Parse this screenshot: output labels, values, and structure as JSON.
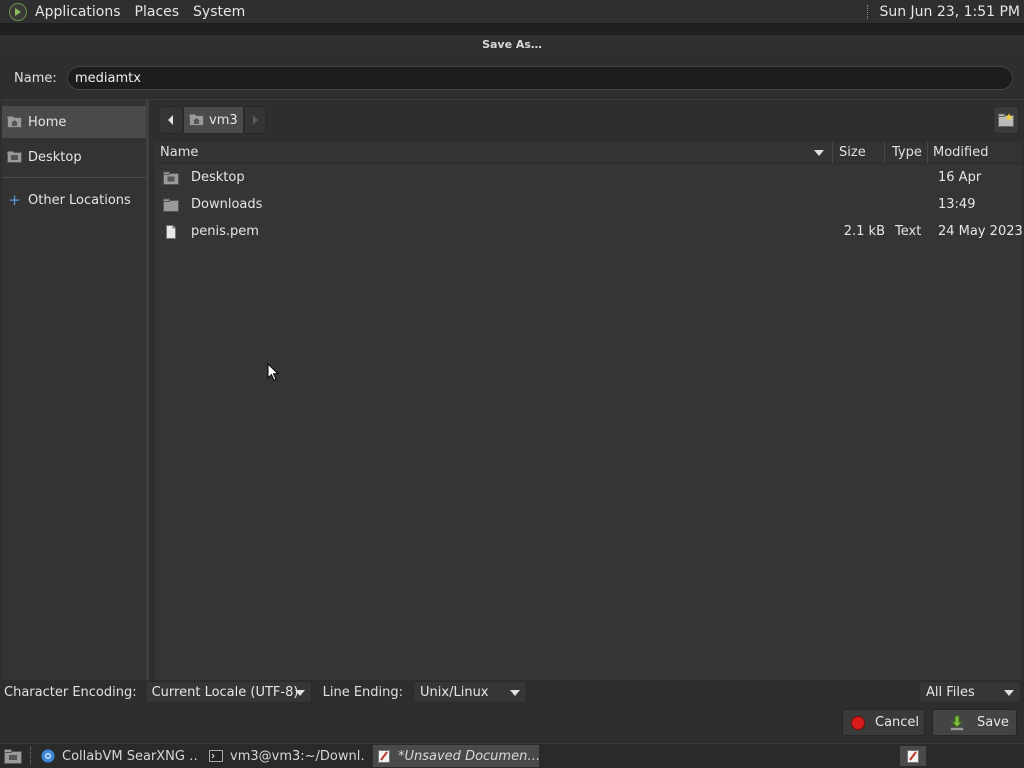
{
  "top_panel": {
    "menus": [
      "Applications",
      "Places",
      "System"
    ],
    "clock": "Sun Jun 23,  1:51 PM"
  },
  "dialog": {
    "title": "Save As…",
    "name_label": "Name:",
    "name_value": "mediamtx"
  },
  "sidebar": {
    "items": [
      {
        "label": "Home"
      },
      {
        "label": "Desktop"
      },
      {
        "label": "Other Locations"
      }
    ]
  },
  "pathbar": {
    "crumb": "vm3"
  },
  "filelist": {
    "columns": {
      "name": "Name",
      "size": "Size",
      "type": "Type",
      "modified": "Modified"
    },
    "rows": [
      {
        "name": "Desktop",
        "size": "",
        "type": "",
        "modified": "16 Apr",
        "icon": "desktop-folder-icon"
      },
      {
        "name": "Downloads",
        "size": "",
        "type": "",
        "modified": "13:49",
        "icon": "folder-icon"
      },
      {
        "name": "penis.pem",
        "size": "2.1 kB",
        "type": "Text",
        "modified": "24 May 2023",
        "icon": "text-file-icon"
      }
    ]
  },
  "options": {
    "encoding_label": "Character Encoding:",
    "encoding_value": "Current Locale (UTF-8)",
    "line_ending_label": "Line Ending:",
    "line_ending_value": "Unix/Linux",
    "filter_value": "All Files"
  },
  "buttons": {
    "cancel": "Cancel",
    "save": "Save"
  },
  "taskbar": {
    "tasks": [
      {
        "label": "CollabVM SearXNG …"
      },
      {
        "label": "vm3@vm3:~/Downl…"
      },
      {
        "label": "*Unsaved Documen…"
      }
    ]
  },
  "colors": {
    "accent_blue": "#5a9be0",
    "cancel_red": "#d81b1b",
    "save_green": "#7cc040"
  }
}
